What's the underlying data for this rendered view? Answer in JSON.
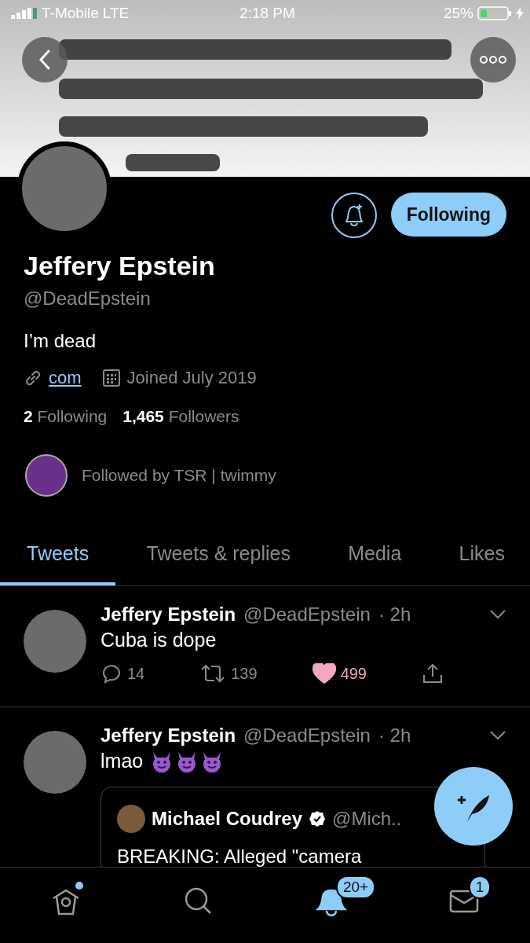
{
  "status_bar": {
    "carrier": "T-Mobile",
    "network": "LTE",
    "time": "2:18 PM",
    "battery": "25%"
  },
  "profile": {
    "name": "Jeffery Epstein",
    "handle": "@DeadEpstein",
    "bio": "I’m dead",
    "link": "com",
    "joined": "Joined July 2019",
    "following_count": "2",
    "following_label": "Following",
    "followers_count": "1,465",
    "followers_label": "Followers",
    "followed_by": "Followed by TSR | twimmy",
    "follow_button": "Following"
  },
  "tabs": [
    {
      "label": "Tweets",
      "selected": true
    },
    {
      "label": "Tweets & replies",
      "selected": false
    },
    {
      "label": "Media",
      "selected": false
    },
    {
      "label": "Likes",
      "selected": false
    }
  ],
  "tweets": [
    {
      "name": "Jeffery Epstein",
      "handle": "@DeadEpstein",
      "time": "· 2h",
      "text": "Cuba is dope",
      "replies": "14",
      "retweets": "139",
      "likes": "499",
      "liked": true
    },
    {
      "name": "Jeffery Epstein",
      "handle": "@DeadEpstein",
      "time": "· 2h",
      "text": "lmao",
      "emoji_icons": [
        {
          "kind": "devil"
        },
        {
          "kind": "devil"
        },
        {
          "kind": "devil"
        }
      ],
      "quote": {
        "name": "Michael Coudrey",
        "verified": true,
        "handle": "@Mich..",
        "text": "BREAKING: Alleged \"camera"
      }
    }
  ],
  "nav": [
    {
      "kind": "home",
      "selected": false,
      "dot": true
    },
    {
      "kind": "search",
      "selected": false
    },
    {
      "kind": "notifications",
      "selected": true,
      "badge": "20+"
    },
    {
      "kind": "messages",
      "selected": false,
      "badge": "1"
    }
  ]
}
